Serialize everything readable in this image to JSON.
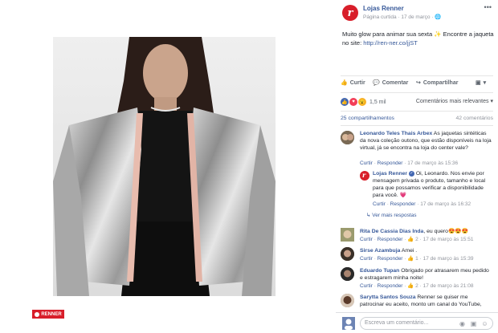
{
  "photo": {
    "brand_tag": "RENNER"
  },
  "post": {
    "page_name": "Lojas Renner",
    "meta": "Página curtida · 17 de março ·",
    "caption_text": "Muito glow para animar sua sexta ✨ Encontre a jaqueta no site: ",
    "caption_link": "http://ren-ner.co/jjST",
    "actions": {
      "like": "Curtir",
      "comment": "Comentar",
      "share": "Compartilhar"
    },
    "reactions_count": "1,5 mil",
    "relevance_label": "Comentários mais relevantes",
    "shares_label": "25 compartilhamentos",
    "comments_label": "42 comentários"
  },
  "comments": [
    {
      "author": "Leonardo Teles Thais Arbex",
      "text": "As jaquetas sintéticas da nova coleção outono, que estão disponíveis na loja virtual, já se encontra na loja do center vale?",
      "like": "Curtir",
      "reply": "Responder",
      "time": "17 de março às 15:36"
    },
    {
      "author": "Lojas Renner",
      "text": "Oi, Leonardo. Nos envie por mensagem privada o produto, tamanho e local para que possamos verificar a disponibilidade para você. 💗",
      "like": "Curtir",
      "reply": "Responder",
      "time": "17 de março às 16:32"
    },
    {
      "author": "Rita De Cassia Dias Inda",
      "text": ", eu quero😍😍😍",
      "like": "Curtir",
      "reply": "Responder",
      "reacts": "2",
      "time": "17 de março às 15:51"
    },
    {
      "author": "Sirse Azambuja",
      "text": "Amei .",
      "like": "Curtir",
      "reply": "Responder",
      "reacts": "1",
      "time": "17 de março às 15:39"
    },
    {
      "author": "Eduardo Tupan",
      "text": "Obrigado por atrasarem meu pedido e estragarem minha noite!",
      "like": "Curtir",
      "reply": "Responder",
      "reacts": "2",
      "time": "17 de março às 21:08"
    },
    {
      "author": "Sarytta Santos Souza",
      "text": "Renner se quiser me patrocinar eu aceito, monto um canal do YouTube,"
    }
  ],
  "more_replies": "Ver mais respostas",
  "composer": {
    "placeholder": "Escreva um comentário..."
  }
}
